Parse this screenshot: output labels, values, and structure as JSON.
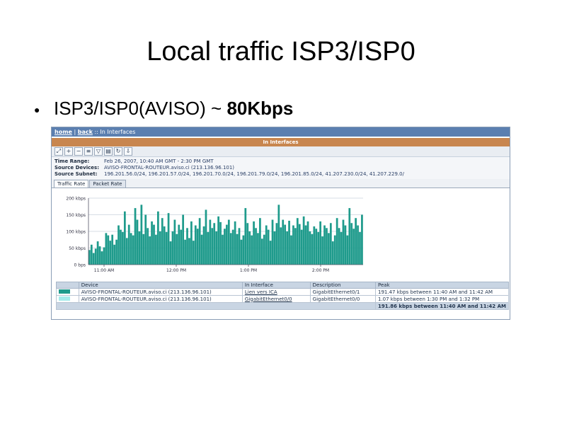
{
  "slide": {
    "title": "Local traffic ISP3/ISP0",
    "bullet_prefix": "ISP3/ISP0(AVISO) ~ ",
    "bullet_strong": "80Kbps"
  },
  "screenshot": {
    "nav": {
      "home": "home",
      "sep1": " | ",
      "back": "back",
      "crumb": " :: In Interfaces"
    },
    "panel_title": "In Interfaces",
    "toolbar_icons": [
      "zoom-icon",
      "zoom-in-icon",
      "zoom-out-icon",
      "list-icon",
      "filter-icon",
      "print-icon",
      "refresh-icon",
      "export-icon"
    ],
    "info": {
      "time_range_label": "Time Range:",
      "time_range_value": "Feb 26, 2007, 10:40 AM GMT - 2:30 PM GMT",
      "source_devices_label": "Source Devices:",
      "source_devices_value": "AVISO-FRONTAL-ROUTEUR.aviso.ci (213.136.96.101)",
      "source_subnet_label": "Source Subnet:",
      "source_subnet_value": "196.201.56.0/24, 196.201.57.0/24, 196.201.70.0/24, 196.201.79.0/24, 196.201.85.0/24, 41.207.230.0/24, 41.207.229.0/"
    },
    "tabs": [
      "Traffic Rate",
      "Packet Rate"
    ],
    "legend": {
      "headers": [
        "",
        "Device",
        "In Interface",
        "Description",
        "Peak"
      ],
      "rows": [
        {
          "color": "#1f9b8c",
          "device": "AVISO-FRONTAL-ROUTEUR.aviso.ci (213.136.96.101)",
          "interface": "Lien vers ICA",
          "description": "GigabitEthernet0/1",
          "peak": "191.47 kbps between 11:40 AM and 11:42 AM"
        },
        {
          "color": "#a6ecec",
          "device": "AVISO-FRONTAL-ROUTEUR.aviso.ci (213.136.96.101)",
          "interface": "GigabitEthernet0/0",
          "description": "GigabitEthernet0/0",
          "peak": "1.07 kbps between 1:30 PM and 1:32 PM"
        }
      ],
      "total": "191.86 kbps between 11:40 AM and 11:42 AM"
    }
  },
  "chart_data": {
    "type": "bar",
    "yticks": [
      "200 kbps",
      "150 kbps",
      "100 kbps",
      "50 kbps",
      "0 bps"
    ],
    "ylim": [
      0,
      200
    ],
    "xticks": [
      "11:00 AM",
      "12:00 PM",
      "1:00 PM",
      "2:00 PM"
    ],
    "colors": {
      "main": "#1f9b8c",
      "secondary": "#a6ecec"
    },
    "series": [
      {
        "name": "Lien vers ICA",
        "values": [
          44,
          60,
          35,
          48,
          70,
          55,
          40,
          52,
          95,
          88,
          72,
          90,
          60,
          75,
          118,
          105,
          98,
          160,
          80,
          120,
          95,
          88,
          170,
          135,
          100,
          180,
          92,
          150,
          110,
          85,
          130,
          120,
          90,
          160,
          100,
          140,
          115,
          98,
          155,
          70,
          100,
          135,
          92,
          120,
          105,
          150,
          75,
          110,
          80,
          130,
          72,
          118,
          108,
          140,
          90,
          115,
          165,
          98,
          135,
          110,
          125,
          100,
          145,
          128,
          90,
          108,
          120,
          135,
          95,
          105,
          130,
          92,
          110,
          75,
          88,
          170,
          125,
          100,
          88,
          130,
          110,
          95,
          140,
          78,
          90,
          118,
          105,
          72,
          135,
          100,
          125,
          180,
          112,
          135,
          120,
          100,
          132,
          88,
          118,
          110,
          140,
          122,
          105,
          145,
          118,
          130,
          100,
          92,
          115,
          108,
          98,
          130,
          85,
          118,
          110,
          95,
          125,
          70,
          88,
          140,
          110,
          98,
          135,
          118,
          88,
          170,
          125,
          108,
          140,
          118,
          98,
          150
        ]
      }
    ]
  }
}
